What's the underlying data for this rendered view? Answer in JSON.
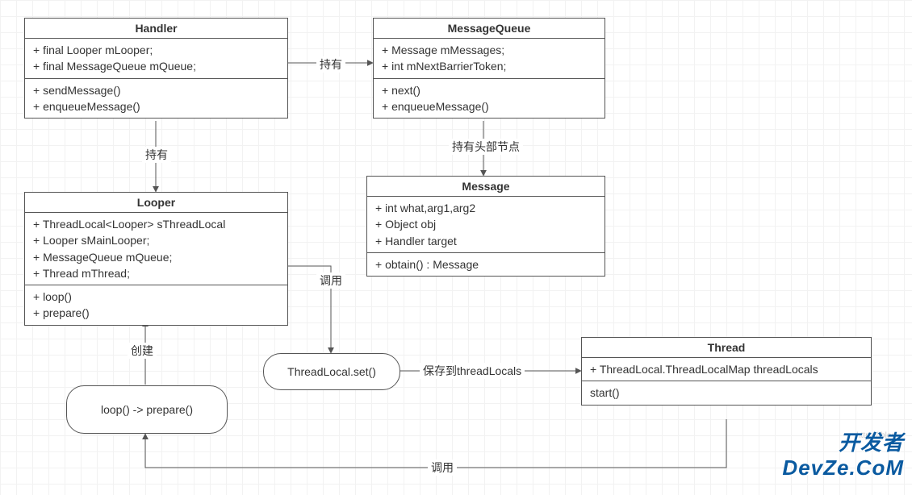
{
  "classes": {
    "handler": {
      "title": "Handler",
      "fields": [
        "+ final Looper mLooper;",
        "+ final MessageQueue mQueue;"
      ],
      "methods": [
        "+ sendMessage()",
        "+ enqueueMessage()"
      ]
    },
    "message_queue": {
      "title": "MessageQueue",
      "fields": [
        "+ Message mMessages;",
        "+ int mNextBarrierToken;"
      ],
      "methods": [
        "+ next()",
        "+ enqueueMessage()"
      ]
    },
    "looper": {
      "title": "Looper",
      "fields": [
        "+ ThreadLocal<Looper> sThreadLocal",
        "+ Looper sMainLooper;",
        "+ MessageQueue mQueue;",
        "+ Thread mThread;"
      ],
      "methods": [
        "+ loop()",
        "+ prepare()"
      ]
    },
    "message": {
      "title": "Message",
      "fields": [
        "+ int what,arg1,arg2",
        "+ Object obj",
        "+ Handler target"
      ],
      "methods": [
        "+ obtain() : Message"
      ]
    },
    "thread": {
      "title": "Thread",
      "fields": [
        "+ ThreadLocal.ThreadLocalMap threadLocals"
      ],
      "methods": [
        "start()"
      ]
    }
  },
  "nodes": {
    "threadlocal_set": "ThreadLocal.set()",
    "loop_prepare": "loop() -> prepare()"
  },
  "edges": {
    "handler_to_mq": "持有",
    "handler_to_looper": "持有",
    "mq_to_message": "持有头部节点",
    "looper_to_tls": "调用",
    "tls_to_thread": "保存到threadLocals",
    "lp_to_looper": "创建",
    "thread_to_lp": "调用"
  },
  "watermark": {
    "cn": "开发者",
    "en": "DevZe.CoM",
    "faint": "https://blog…"
  }
}
